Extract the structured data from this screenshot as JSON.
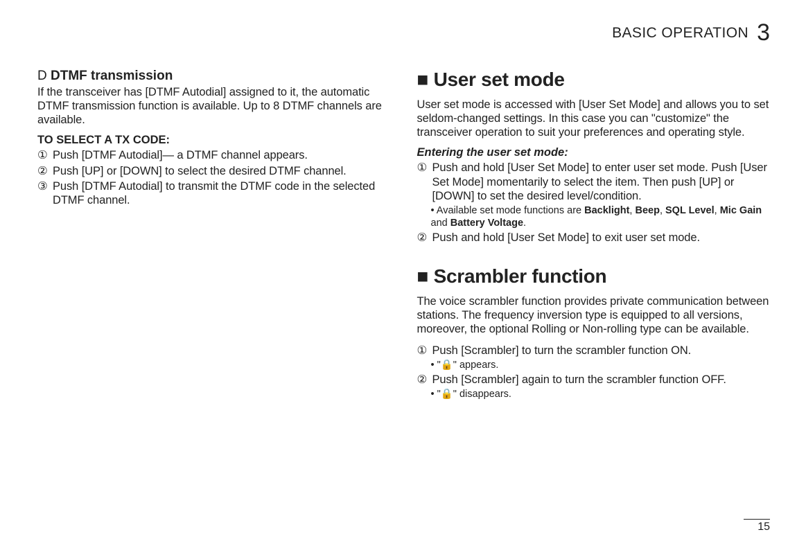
{
  "header": {
    "title": "BASIC OPERATION",
    "chapter_number": "3"
  },
  "footer": {
    "page": "15"
  },
  "left": {
    "subheading_prefix": "D ",
    "subheading": "DTMF transmission",
    "intro": "If the transceiver has [DTMF Autodial] assigned to it, the automatic DTMF transmission function is available. Up to 8 DTMF channels are available.",
    "select_label": "TO SELECT A TX CODE:",
    "steps": {
      "1": {
        "num": "①",
        "text": "Push [DTMF Autodial]— a DTMF channel appears."
      },
      "2": {
        "num": "②",
        "text": "Push [UP] or [DOWN] to select the desired DTMF channel."
      },
      "3": {
        "num": "③",
        "text": "Push [DTMF Autodial] to transmit the DTMF code in the selected DTMF channel."
      }
    }
  },
  "right": {
    "section1": {
      "prefix": "■ ",
      "title": "User set mode",
      "para": "User set mode is accessed with [User Set Mode] and allows you to set seldom-changed settings. In this case you can \"customize\" the transceiver operation to suit your preferences and operating style.",
      "entering_label": "Entering the user set mode:",
      "step1": {
        "num": "①",
        "text": "Push and hold [User Set Mode] to enter user set mode. Push [User Set Mode] momentarily to select the item. Then push [UP] or [DOWN] to set the desired level/condition."
      },
      "note1_prefix": "• Available set mode functions are ",
      "note1_bold1": "Backlight",
      "note1_sep1": ", ",
      "note1_bold2": "Beep",
      "note1_sep2": ", ",
      "note1_bold3": "SQL Level",
      "note1_sep3": ", ",
      "note1_bold4": "Mic Gain",
      "note1_mid": " and ",
      "note1_bold5": "Battery Voltage",
      "note1_end": ".",
      "step2": {
        "num": "②",
        "text": "Push and hold [User Set Mode] to exit user set mode."
      }
    },
    "section2": {
      "prefix": "■ ",
      "title": "Scrambler function",
      "para": "The voice scrambler function provides private communication between stations. The frequency inversion type is equipped to all versions, moreover, the optional Rolling or Non-rolling type can be available.",
      "step1": {
        "num": "①",
        "text": "Push [Scrambler] to turn the scrambler function ON."
      },
      "note1": "• \"🔒\" appears.",
      "step2": {
        "num": "②",
        "text": "Push [Scrambler] again to turn the scrambler function OFF."
      },
      "note2": "• \"🔒\" disappears."
    }
  }
}
